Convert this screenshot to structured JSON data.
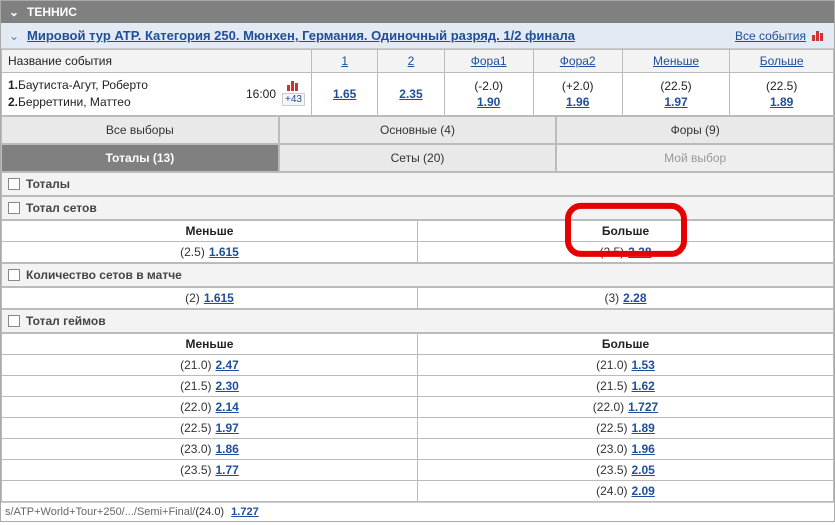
{
  "sport": {
    "name": "ТЕННИС"
  },
  "tour": {
    "title": "Мировой тур ATP. Категория 250. Мюнхен, Германия. Одиночный разряд. 1/2 финала",
    "all_events": "Все события"
  },
  "columns": {
    "name": "Название события",
    "c1": "1",
    "c2": "2",
    "fora1": "Фора1",
    "fora2": "Фора2",
    "less": "Меньше",
    "more": "Больше"
  },
  "event": {
    "p1_num": "1.",
    "p1": "Баутиста-Агут, Роберто",
    "p2_num": "2.",
    "p2": "Берреттини, Маттео",
    "time": "16:00",
    "expand": "+43",
    "o1": "1.65",
    "o2": "2.35",
    "f1_line": "(-2.0)",
    "f1_val": "1.90",
    "f2_line": "(+2.0)",
    "f2_val": "1.96",
    "less_line": "(22.5)",
    "less_val": "1.97",
    "more_line": "(22.5)",
    "more_val": "1.89"
  },
  "tabs": {
    "all": "Все выборы",
    "main": "Основные (4)",
    "handicap": "Форы (9)",
    "totals": "Тоталы (13)",
    "sets": "Сеты (20)",
    "mine": "Мой выбор"
  },
  "sections": {
    "totals": "Тоталы",
    "total_sets": "Тотал сетов",
    "sets_count": "Количество сетов в матче",
    "total_games": "Тотал геймов"
  },
  "labels": {
    "less": "Меньше",
    "more": "Больше"
  },
  "total_sets": {
    "less": {
      "line": "(2.5)",
      "val": "1.615"
    },
    "more": {
      "line": "(2.5)",
      "val": "2.28"
    }
  },
  "sets_count": {
    "two": {
      "line": "(2)",
      "val": "1.615"
    },
    "three": {
      "line": "(3)",
      "val": "2.28"
    }
  },
  "total_games": {
    "rows": [
      {
        "line": "(21.0)",
        "less": "2.47",
        "more": "1.53"
      },
      {
        "line": "(21.5)",
        "less": "2.30",
        "more": "1.62"
      },
      {
        "line": "(22.0)",
        "less": "2.14",
        "more": "1.727"
      },
      {
        "line": "(22.5)",
        "less": "1.97",
        "more": "1.89"
      },
      {
        "line": "(23.0)",
        "less": "1.86",
        "more": "1.96"
      },
      {
        "line": "(23.5)",
        "less": "1.77",
        "more": "2.05"
      },
      {
        "line_less": "(24.0)",
        "less": "1.727",
        "line_more": "(24.0)",
        "more": "2.09"
      }
    ]
  },
  "footer": {
    "path": "s/ATP+World+Tour+250/.../Semi+Final/"
  }
}
